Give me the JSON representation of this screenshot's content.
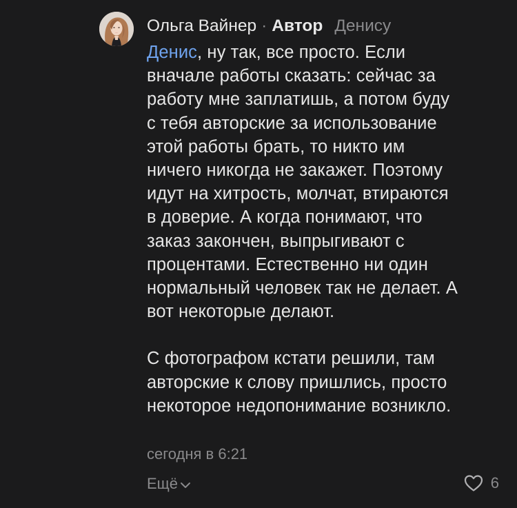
{
  "comment": {
    "author_name": "Ольга Вайнер",
    "separator": "·",
    "author_badge": "Автор",
    "reply_to": "Денису",
    "mention": "Денис",
    "paragraph1_rest": ", ну так, все просто. Если\nвначале работы сказать: сейчас за\nработу мне заплатишь, а потом буду\nс тебя авторские за использование\nэтой работы брать, то никто им\nничего никогда не закажет. Поэтому\nидут на хитрость, молчат, втираются\nв доверие. А когда понимают, что\nзаказ закончен, выпрыгивают с\nпроцентами. Естественно ни один\nнормальный человек так не делает. А\nвот некоторые делают.",
    "paragraph2": "С фотографом кстати решили, там\nавторские к слову пришлись, просто\nнекоторое недопонимание возникло.",
    "timestamp": "сегодня в 6:21",
    "more_label": "Ещё",
    "like_count": "6"
  },
  "icons": {
    "avatar": "avatar-photo",
    "chevron": "chevron-down-icon",
    "like": "heart-outline-icon"
  },
  "colors": {
    "background": "#1b1b1c",
    "text": "#e6e6e6",
    "secondary_text": "#8a8a8c",
    "mention": "#6fa3ee"
  }
}
